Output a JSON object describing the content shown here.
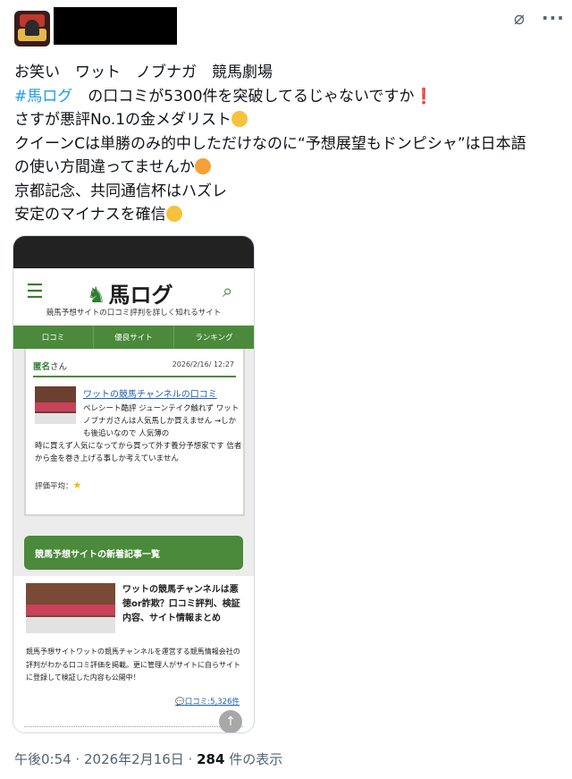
{
  "tweet": {
    "lines": [
      "お笑い　ワット　ノブナガ　競馬劇場",
      "#馬ログ",
      "　の口コミが5300件を突破してるじゃないですか",
      "さすが悪評No.1の金メダリスト",
      "クイーンCは単勝のみ的中しただけなのに“予想展望もドンピシャ”は日本語",
      "の使い方間違ってませんか",
      "京都記念、共同通信杯はハズレ",
      "安定のマイナスを確信"
    ]
  },
  "card": {
    "logo": "馬ログ",
    "subtitle": "競馬予想サイトの口コミ評判を詳しく知れるサイト",
    "nav": [
      "口コミ",
      "優良サイト",
      "ランキング"
    ],
    "review": {
      "name": "匿名",
      "name_suffix": "さん",
      "date": "2026/2/16/ 12:27",
      "link": "ワットの競馬チャンネルの口コミ",
      "text1": "ペレシート酷評 ジューンテイク触れず ワットノブナガさんは人気馬しか買えません →しかも後追いなので 人気薄の",
      "text2": "時に買えず人気になってから買って外す養分予想家です 信者から金を巻き上げる事しか考えていません",
      "rating_label": "評価平均："
    },
    "section_title": "競馬予想サイトの新着記事一覧",
    "article": {
      "title": "ワットの競馬チャンネルは悪徳or詐欺？口コミ評判、検証内容、サイト情報まとめ",
      "desc": "競馬予想サイトワットの競馬チャンネルを運営する競馬情報会社の評判がわかる口コミ評価を掲載。更に管理人がサイトに自らサイトに登録して検証した内容も公開中！",
      "count": "口コミ:5,326件"
    }
  },
  "meta": {
    "time": "午後0:54 · 2026年2月16日 · ",
    "views": "284",
    "views_suffix": " 件の表示"
  },
  "icons": {
    "grok": "slash-circle-icon",
    "more": "more-icon",
    "menu": "hamburger-icon",
    "search": "search-icon",
    "horse": "horse-icon",
    "scroll_up": "arrow-up-icon"
  },
  "colors": {
    "accent": "#1d9bf0",
    "site_green": "#4a8a3a",
    "muted": "#536471"
  }
}
